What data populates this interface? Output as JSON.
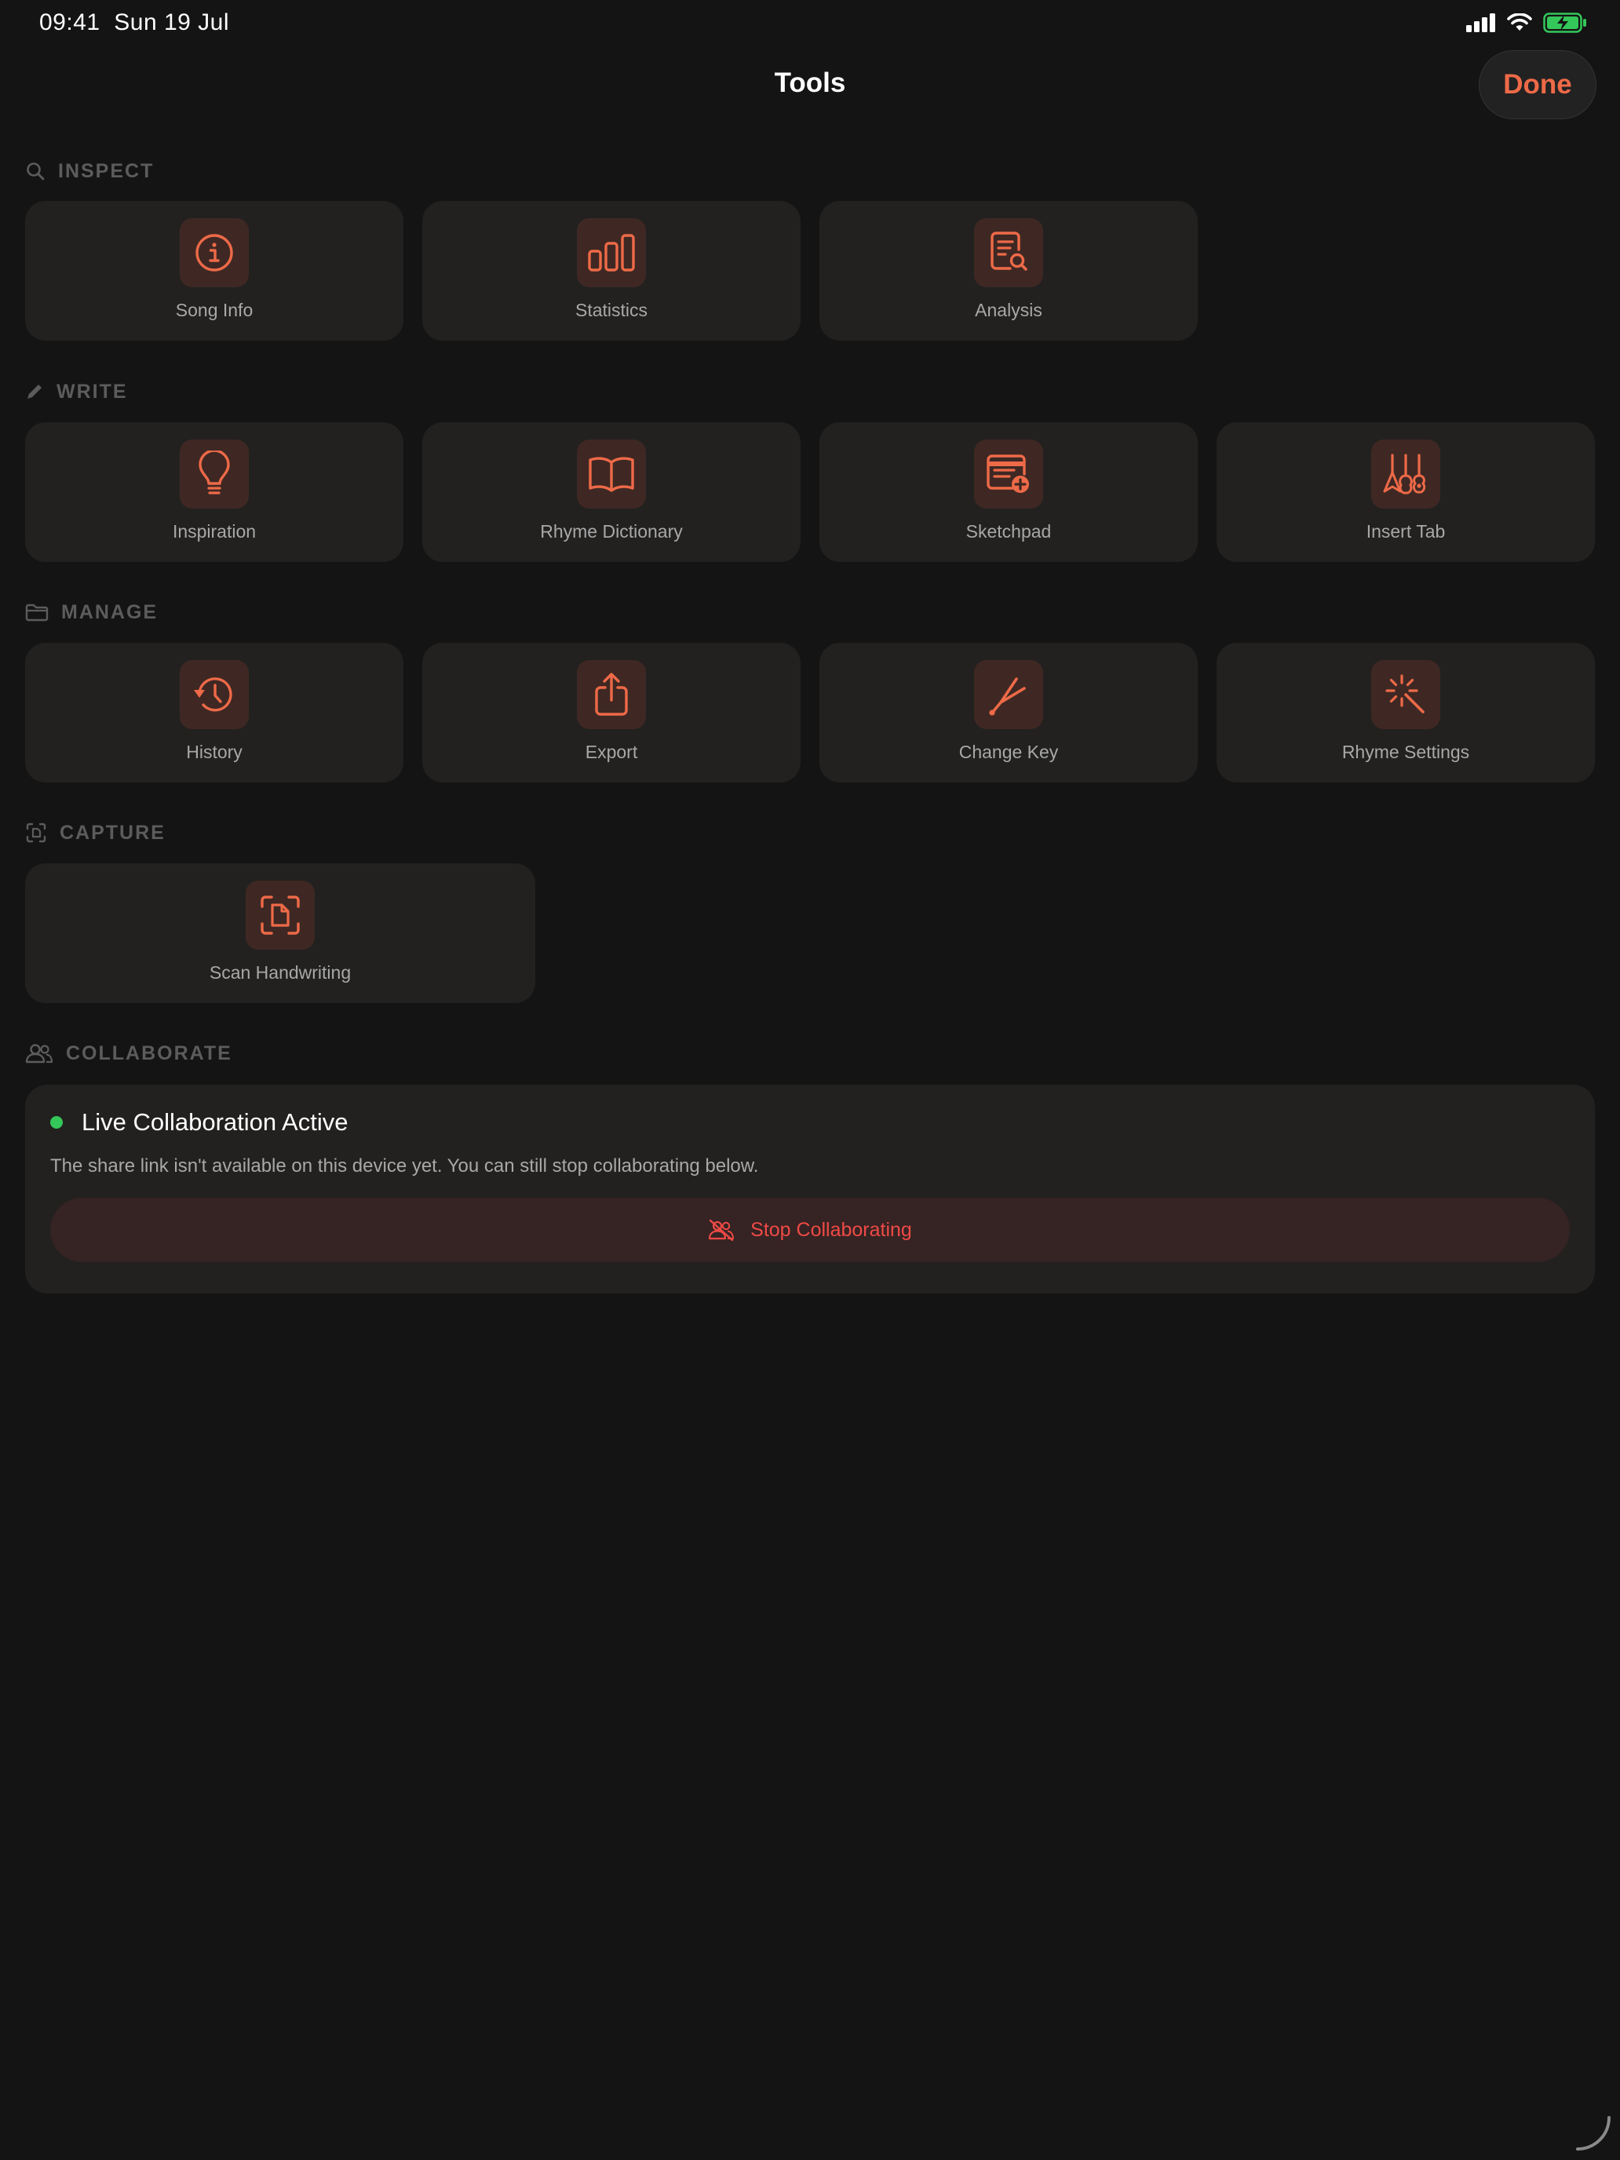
{
  "status_bar": {
    "time": "09:41",
    "date": "Sun 19 Jul",
    "icons": [
      "cellular-signal-icon",
      "wifi-icon",
      "battery-charging-icon"
    ]
  },
  "nav": {
    "title": "Tools",
    "done_label": "Done"
  },
  "sections": {
    "inspect": {
      "label": "INSPECT",
      "icon": "search-icon",
      "tools": [
        {
          "label": "Song Info",
          "icon": "info-circle-icon"
        },
        {
          "label": "Statistics",
          "icon": "bar-chart-icon"
        },
        {
          "label": "Analysis",
          "icon": "document-magnifier-icon"
        }
      ]
    },
    "write": {
      "label": "WRITE",
      "icon": "pencil-icon",
      "tools": [
        {
          "label": "Inspiration",
          "icon": "lightbulb-icon"
        },
        {
          "label": "Rhyme Dictionary",
          "icon": "open-book-icon"
        },
        {
          "label": "Sketchpad",
          "icon": "sketch-add-icon"
        },
        {
          "label": "Insert Tab",
          "icon": "guitars-icon"
        }
      ]
    },
    "manage": {
      "label": "MANAGE",
      "icon": "folder-icon",
      "tools": [
        {
          "label": "History",
          "icon": "history-clock-icon"
        },
        {
          "label": "Export",
          "icon": "share-icon"
        },
        {
          "label": "Change Key",
          "icon": "tuning-fork-icon"
        },
        {
          "label": "Rhyme Settings",
          "icon": "magic-wand-icon"
        }
      ]
    },
    "capture": {
      "label": "CAPTURE",
      "icon": "scan-text-icon",
      "tools": [
        {
          "label": "Scan Handwriting",
          "icon": "document-scanner-icon"
        }
      ]
    },
    "collaborate": {
      "label": "COLLABORATE",
      "icon": "people-icon",
      "status_title": "Live Collaboration Active",
      "description": "The share link isn't available on this device yet. You can still stop collaborating below.",
      "stop_label": "Stop Collaborating",
      "stop_icon": "people-slash-icon"
    }
  },
  "colors": {
    "accent": "#ee6a48",
    "destructive": "#ee4a46",
    "live": "#34c759",
    "background": "#141414",
    "card": "#222120"
  }
}
